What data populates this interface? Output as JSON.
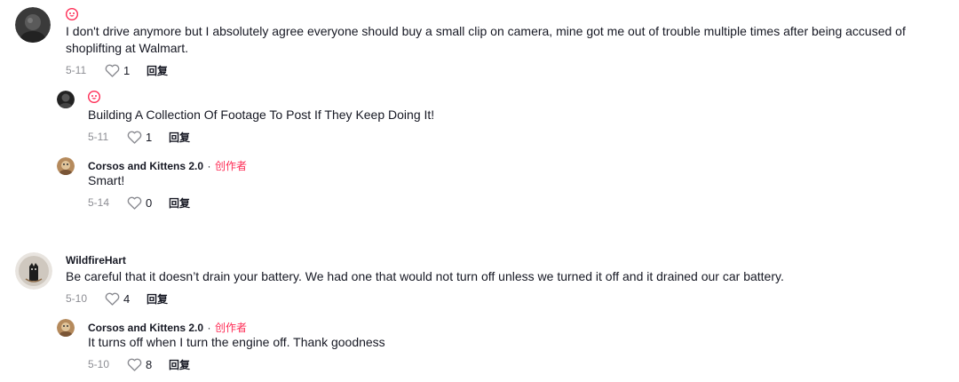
{
  "comments": [
    {
      "text": "I don't drive anymore but I absolutely agree everyone should buy a small clip on camera, mine got me out of trouble multiple times after being accused of shoplifting at Walmart.",
      "date": "5-11",
      "likes": "1",
      "reply_label": "回复",
      "badge_icon": "heart-face-badge-icon",
      "replies": [
        {
          "text": "Building A Collection Of Footage To Post If They Keep Doing It!",
          "date": "5-11",
          "likes": "1",
          "reply_label": "回复",
          "badge_icon": "heart-face-badge-icon"
        },
        {
          "username": "Corsos and Kittens 2.0",
          "separator": "·",
          "creator_label": "创作者",
          "text": "Smart!",
          "date": "5-14",
          "likes": "0",
          "reply_label": "回复"
        }
      ]
    },
    {
      "username": "WildfireHart",
      "text": "Be careful that it doesn’t drain your battery. We had one that would not turn off unless we turned it off and it drained our car battery.",
      "date": "5-10",
      "likes": "4",
      "reply_label": "回复",
      "replies": [
        {
          "username": "Corsos and Kittens 2.0",
          "separator": "·",
          "creator_label": "创作者",
          "text": "It turns off when I turn the engine off. Thank goodness",
          "date": "5-10",
          "likes": "8",
          "reply_label": "回复"
        }
      ]
    }
  ],
  "colors": {
    "creator": "#fe2c55",
    "text": "#161823",
    "muted": "rgba(22,24,35,0.5)"
  }
}
